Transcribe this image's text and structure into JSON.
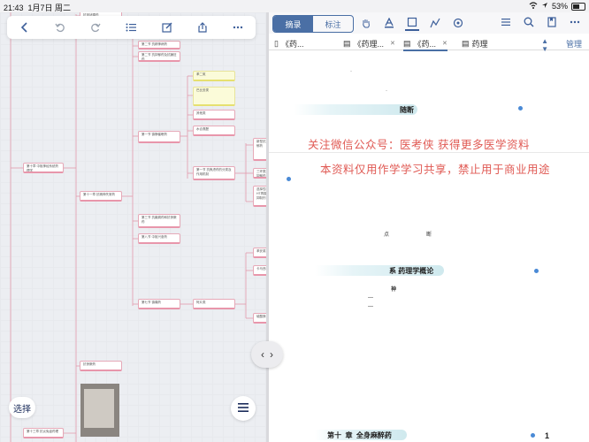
{
  "status": {
    "time": "21:43",
    "date": "1月7日 周二",
    "battery": "53%"
  },
  "mindmap": {
    "toolbar": [
      "back-icon",
      "undo-icon",
      "redo-icon",
      "outline-list-icon",
      "edit-icon",
      "share-icon",
      "more-icon"
    ],
    "select_label": "选择",
    "nodes": {
      "n1": "第十二章 抗甲状腺激素及抗甲状腺药",
      "n2": "第十一章 抗精神失常药",
      "n3": "第二节 抗精神病药",
      "n4": "第一节 镇静催眠药",
      "n5": "第一节 抗焦虑药的分类及作用机制",
      "n6": "第二节 抗抑郁药及抗躁狂药",
      "n7": "第八节 中枢兴奋药",
      "n8": "第三节 抗帕金森病药",
      "n9": "第七节 镇痛药",
      "n10": "第三节 抗癫痫药和抗惊厥药",
      "n11": "阿片类",
      "n12": "抗惊厥药",
      "n13": "第十章 中枢神经系统药理学",
      "n14": "第十三章 抗炎免疫药理",
      "y1": "苯二氮",
      "y2": "巴比妥类",
      "y3": "其他类",
      "y4": "水合氯醛",
      "r1": "新型抗抑郁药",
      "r2": "三环类抗抑郁药",
      "r3": "选择性5-HT再摄取抑制剂",
      "r4": "单胺氧化酶抑制剂",
      "r5": "苯妥英钠",
      "r6": "卡马西平",
      "r7": "硫酸镁"
    }
  },
  "reader": {
    "segment": {
      "on": "摘录",
      "off": "标注"
    },
    "tabs": [
      "《药...",
      "《药理...",
      "《药...",
      "药理"
    ],
    "manage": "管理",
    "page": {
      "band1": "随断",
      "watermark1": "关注微信公众号：医考侠      获得更多医学资料",
      "watermark2": "本资料仅用作学学习共享，禁止用于商业用途",
      "frag1": "点",
      "frag2": "断",
      "band2": "系    药理学概论",
      "frag3": "神",
      "band3_prefix": "第十",
      "band3_mid": "章",
      "band3": "全身麻醉药",
      "page_num": "1"
    }
  },
  "colors": {
    "accent": "#4a6fa5",
    "watermark": "#e05a54",
    "node_border": "#e896ab"
  }
}
